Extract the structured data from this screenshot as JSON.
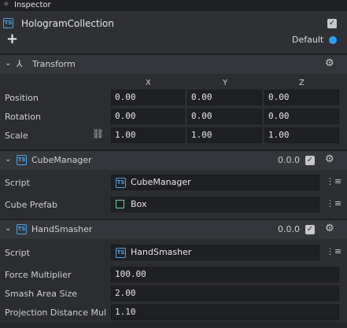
{
  "panel": {
    "pin_icon": "pin-icon",
    "title": "Inspector"
  },
  "object": {
    "type_badge": "TS",
    "name": "HologramCollection",
    "enabled": true,
    "add_label": "+",
    "layer_label": "Default",
    "layer_color": "#2d9cff"
  },
  "transform": {
    "title": "Transform",
    "axes": [
      "X",
      "Y",
      "Z"
    ],
    "position": {
      "label": "Position",
      "x": "0.00",
      "y": "0.00",
      "z": "0.00"
    },
    "rotation": {
      "label": "Rotation",
      "x": "0.00",
      "y": "0.00",
      "z": "0.00"
    },
    "scale": {
      "label": "Scale",
      "x": "1.00",
      "y": "1.00",
      "z": "1.00"
    }
  },
  "cube_manager": {
    "title": "CubeManager",
    "version": "0.0.0",
    "enabled": true,
    "script_label": "Script",
    "script_value": "CubeManager",
    "prefab_label": "Cube Prefab",
    "prefab_value": "Box"
  },
  "hand_smasher": {
    "title": "HandSmasher",
    "version": "0.0.0",
    "enabled": true,
    "script_label": "Script",
    "script_value": "HandSmasher",
    "force_label": "Force Multiplier",
    "force_value": "100.00",
    "smash_label": "Smash Area Size",
    "smash_value": "2.00",
    "projection_label": "Projection Distance Mul",
    "projection_value": "1.10"
  }
}
